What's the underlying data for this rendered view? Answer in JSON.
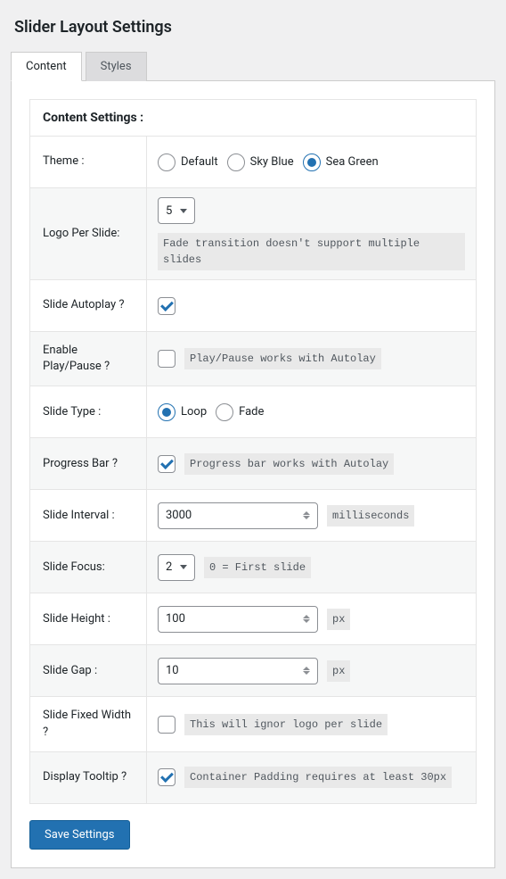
{
  "page_title": "Slider Layout Settings",
  "tabs": {
    "content": "Content",
    "styles": "Styles",
    "active": "content"
  },
  "section_title": "Content Settings :",
  "theme": {
    "label": "Theme :",
    "options": {
      "default": "Default",
      "skyblue": "Sky Blue",
      "seagreen": "Sea Green"
    },
    "selected": "seagreen"
  },
  "logo_per_slide": {
    "label": "Logo Per Slide:",
    "value": "5",
    "hint": "Fade transition doesn't support multiple slides"
  },
  "slide_autoplay": {
    "label": "Slide Autoplay ?",
    "checked": true
  },
  "enable_playpause": {
    "label": "Enable Play/Pause ?",
    "checked": false,
    "hint": "Play/Pause works with Autolay"
  },
  "slide_type": {
    "label": "Slide Type :",
    "options": {
      "loop": "Loop",
      "fade": "Fade"
    },
    "selected": "loop"
  },
  "progress_bar": {
    "label": "Progress Bar ?",
    "checked": true,
    "hint": "Progress bar works with Autolay"
  },
  "slide_interval": {
    "label": "Slide Interval :",
    "value": "3000",
    "unit": "milliseconds"
  },
  "slide_focus": {
    "label": "Slide Focus:",
    "value": "2",
    "hint": "0 = First slide"
  },
  "slide_height": {
    "label": "Slide Height :",
    "value": "100",
    "unit": "px"
  },
  "slide_gap": {
    "label": "Slide Gap :",
    "value": "10",
    "unit": "px"
  },
  "slide_fixed_width": {
    "label": "Slide Fixed Width ?",
    "checked": false,
    "hint": "This will ignor logo per slide"
  },
  "display_tooltip": {
    "label": "Display Tooltip ?",
    "checked": true,
    "hint": "Container Padding requires at least 30px"
  },
  "save_button": "Save Settings"
}
